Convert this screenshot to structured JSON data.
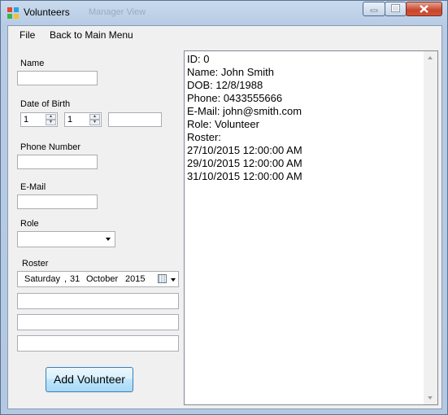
{
  "window": {
    "title": "Volunteers",
    "background_title": "Manager View",
    "minimize_icon": "minimize-icon",
    "maximize_icon": "maximize-icon",
    "close_icon": "close-icon"
  },
  "menu": {
    "file": "File",
    "back": "Back to Main Menu"
  },
  "form": {
    "name_label": "Name",
    "name_value": "",
    "dob_label": "Date of Birth",
    "dob_day": "1",
    "dob_month": "1",
    "dob_year": "",
    "phone_label": "Phone Number",
    "phone_value": "",
    "email_label": "E-Mail",
    "email_value": "",
    "role_label": "Role",
    "role_value": "",
    "roster_label": "Roster",
    "roster_date": {
      "weekday": "Saturday",
      "sep": ",",
      "day": "31",
      "month": "October",
      "year": "2015"
    },
    "roster_fields": [
      "",
      "",
      ""
    ],
    "add_button": "Add Volunteer"
  },
  "details": {
    "lines": [
      "ID: 0",
      "Name: John Smith",
      "DOB: 12/8/1988",
      "Phone: 0433555666",
      "E-Mail: john@smith.com",
      "Role: Volunteer",
      "Roster:",
      "27/10/2015 12:00:00 AM",
      "29/10/2015 12:00:00 AM",
      "31/10/2015 12:00:00 AM"
    ]
  }
}
